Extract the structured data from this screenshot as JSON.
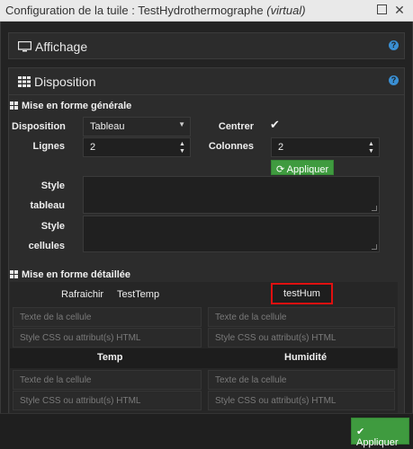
{
  "window": {
    "title_prefix": "Configuration de la tuile : TestHydrothermographe ",
    "title_suffix": "(virtual)"
  },
  "affichage": {
    "title": "Affichage"
  },
  "disposition": {
    "title": "Disposition",
    "mise_en_forme_generale": "Mise en forme générale",
    "disposition_label": "Disposition",
    "disposition_value": "Tableau",
    "centrer_label": "Centrer",
    "lignes_label": "Lignes",
    "lignes_value": "2",
    "colonnes_label": "Colonnes",
    "colonnes_value": "2",
    "appliquer_label": "Appliquer",
    "style_tableau_1": "Style",
    "style_tableau_2": "tableau",
    "style_cellules_1": "Style",
    "style_cellules_2": "cellules",
    "mise_en_forme_detaillee": "Mise en forme détaillée",
    "cells": {
      "rafraichir": "Rafraichir",
      "testtemp": "TestTemp",
      "testhum": "testHum",
      "texte_placeholder": "Texte de la cellule",
      "style_placeholder": "Style CSS ou attribut(s) HTML",
      "temp": "Temp",
      "humidite": "Humidité"
    }
  },
  "footer": {
    "apply_label": "Appliquer"
  },
  "colors": {
    "accent_green": "#3f9b3f",
    "highlight_red": "#e01010",
    "help_blue": "#3a8fd3"
  }
}
